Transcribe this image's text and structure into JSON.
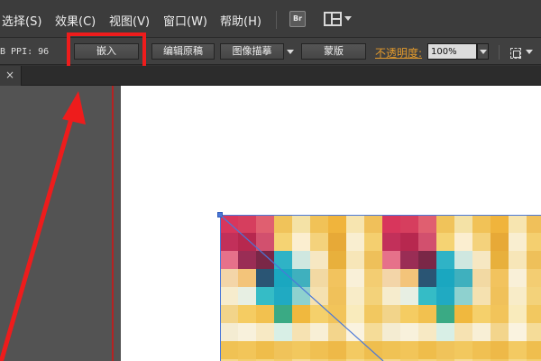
{
  "menubar": {
    "items": [
      "选择(S)",
      "效果(C)",
      "视图(V)",
      "窗口(W)",
      "帮助(H)"
    ],
    "bridge_label": "Br"
  },
  "controlbar": {
    "color_info": "B  PPI: 96",
    "embed_label": "嵌入",
    "edit_original_label": "编辑原稿",
    "image_trace_label": "图像描摹",
    "mask_label": "蒙版",
    "opacity_label": "不透明度:",
    "opacity_value": "100%"
  },
  "tab": {
    "close_symbol": "×"
  },
  "colors": {
    "highlight": "#ee1c1c",
    "opacity_label": "#e39a2c",
    "selection": "#4a78d9",
    "artboard": "#ffffff",
    "pasteboard": "#535353"
  },
  "icons": [
    "bridge-icon",
    "arrange-documents-icon",
    "chevron-down-icon",
    "close-icon",
    "transform-icon",
    "annotation-arrow"
  ]
}
